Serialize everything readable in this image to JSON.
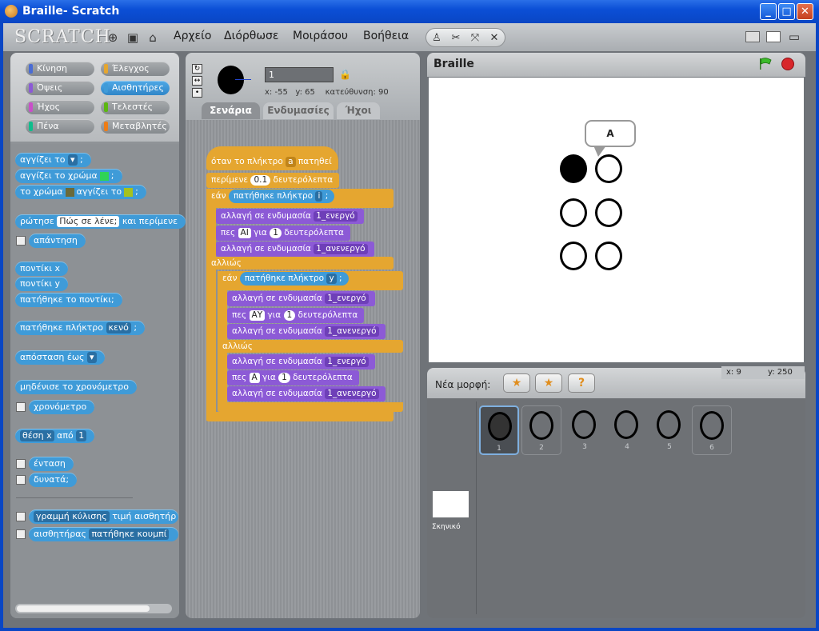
{
  "window": {
    "title": "Braille- Scratch",
    "min": "_",
    "max": "□",
    "close": "✕"
  },
  "menubar": {
    "logo": "SCRATCH",
    "menus": [
      "Αρχείο",
      "Διόρθωσε",
      "Μοιράσου",
      "Βοήθεια"
    ]
  },
  "categories": [
    "Κίνηση",
    "Έλεγχος",
    "Όψεις",
    "Αισθητήρες",
    "Ήχος",
    "Τελεστές",
    "Πένα",
    "Μεταβλητές"
  ],
  "palette_blocks": {
    "touching": "αγγίζει το",
    "touching_color": "αγγίζει το χρώμα",
    "color_touching_a": "το χρώμα",
    "color_touching_b": "αγγίζει το",
    "ask": "ρώτησε",
    "ask_default": "Πώς σε λένε;",
    "ask_wait": "και περίμενε",
    "answer": "απάντηση",
    "mouse_x": "ποντίκι x",
    "mouse_y": "ποντίκι y",
    "mouse_down": "πατήθηκε το ποντίκι;",
    "key_pressed": "πατήθηκε πλήκτρο",
    "key_space": "κενό",
    "distance_to": "απόσταση έως",
    "reset_timer": "μηδένισε το χρονόμετρο",
    "timer": "χρονόμετρο",
    "attr_of_a": "θέση x",
    "attr_of_b": "από",
    "attr_of_val": "1",
    "loudness": "ένταση",
    "loud": "δυνατά;",
    "sensor_value_a": "γραμμή κύλισης",
    "sensor_value_b": "τιμή αισθητήρ",
    "sensor_a": "αισθητήρας",
    "sensor_b": "πατήθηκε κουμπί"
  },
  "sprite": {
    "name": "1",
    "x_label": "x:",
    "x": "-55",
    "y_label": "y:",
    "y": "65",
    "dir_label": "κατεύθυνση:",
    "dir": "90"
  },
  "tabs": [
    "Σενάρια",
    "Ενδυμασίες",
    "Ήχοι"
  ],
  "script": {
    "hat_a": "όταν το πλήκτρο",
    "hat_key": "a",
    "hat_b": "πατηθεί",
    "wait_a": "περίμενε",
    "wait_val": "0.1",
    "wait_b": "δευτερόλεπτα",
    "if": "εάν",
    "key_pressed": "πατήθηκε πλήκτρο",
    "key_i": "i",
    "key_y": "y",
    "switch": "αλλαγή σε ενδυμασία",
    "costume_on": "1_ενεργό",
    "costume_off": "1_ανενεργό",
    "say": "πες",
    "say_for": "για",
    "say_secs": "δευτερόλεπτα",
    "say_ai": "ΑΙ",
    "say_ay": "ΑΥ",
    "say_a": "Α",
    "one": "1",
    "else": "αλλιώς"
  },
  "stage": {
    "title": "Braille",
    "bubble": "Α",
    "mouse_x_label": "x:",
    "mouse_x": "9",
    "mouse_y_label": "y:",
    "mouse_y": "250"
  },
  "library": {
    "new_sprite": "Νέα μορφή:",
    "thumbs": [
      "1",
      "2",
      "3",
      "4",
      "5",
      "6"
    ],
    "stage_label": "Σκηνικό"
  },
  "colors": {
    "control": "#e5a630",
    "looks": "#8c5ad6",
    "sensing": "#3f9bd8"
  }
}
